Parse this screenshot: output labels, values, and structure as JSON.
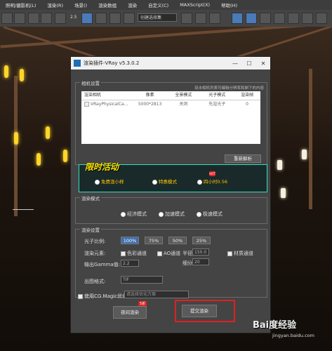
{
  "menu": [
    "照明/摄影机(L)",
    "渲染(R)",
    "场景()",
    "渲染数组",
    "渲染",
    "自定义(C)",
    "MAXScript(X)",
    "帮助(H)"
  ],
  "toolbar": {
    "num_label": "2.5",
    "selection_set": "创建选择集"
  },
  "dialog": {
    "title": "渲染插件-VRay v5.3.0.2",
    "camera_group": "相机设置",
    "hint": "双击相机列表可编辑分辨率和剩下的内容",
    "table_headers": [
      "渲染相机",
      "像素",
      "全景模式",
      "光子模式",
      "渲染帧"
    ],
    "rows": [
      {
        "name": "VRayPhysicalCa...",
        "pixels": "5000*2813",
        "panorama": "关闭",
        "photon": "先渲光子",
        "frame": "0"
      }
    ],
    "reparse_button": "重新解析",
    "promo_title": "限时活动",
    "promo_options": [
      "免费渲小样",
      "特惠模式",
      "四小时0.56"
    ],
    "hot_badge": "HOT",
    "mode_group": "渲染模式",
    "modes": [
      "经济模式",
      "加速模式",
      "极速模式"
    ],
    "settings_group": "渲染设置",
    "photon_ratio_label": "光子比例:",
    "ratios": [
      "100%",
      "75%",
      "50%",
      "25%"
    ],
    "elements_label": "渲染元素:",
    "elem_color": "色彩通道",
    "elem_ao": "AO通道",
    "radius_label": "半径",
    "radius_value": "150.0",
    "elem_material": "材质通道",
    "gamma_label": "输出Gamma值:",
    "gamma_value": "2.2",
    "subdiv_label": "细分",
    "subdiv_value": "20",
    "format_label": "出图格式:",
    "format_value": "TIF",
    "cg_magic_label": "使用CG Magic优化",
    "cg_magic_placeholder": "请选择优化方案",
    "discount_badge": "5折",
    "cost_button": "夜间渲染",
    "submit_button": "提交渲染"
  },
  "watermark": {
    "brand": "Bai度经验",
    "url": "jingyan.baidu.com"
  },
  "colors": {
    "highlight_red": "#e02020",
    "promo_border": "#2ee0c0",
    "promo_title": "#ffe600",
    "active_blue": "#4a7ab8"
  }
}
